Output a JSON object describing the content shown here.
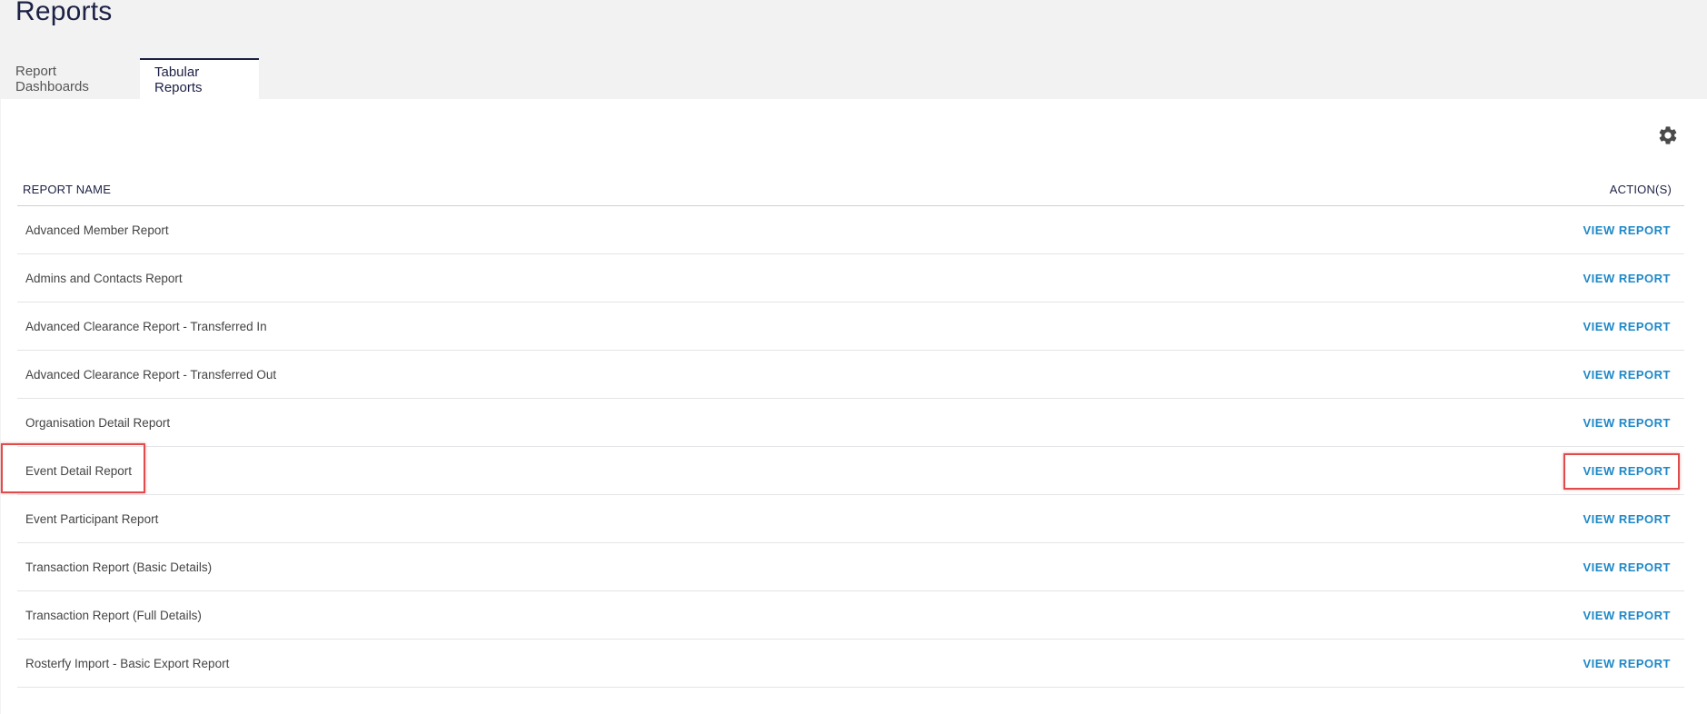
{
  "page": {
    "title": "Reports"
  },
  "tabs": [
    {
      "label": "Report Dashboards",
      "active": false
    },
    {
      "label": "Tabular Reports",
      "active": true
    }
  ],
  "settings": {
    "icon": "gear-icon"
  },
  "table": {
    "headers": {
      "name": "REPORT NAME",
      "actions": "ACTION(S)"
    },
    "rows": [
      {
        "name": "Advanced Member Report",
        "action": "VIEW REPORT"
      },
      {
        "name": "Admins and Contacts Report",
        "action": "VIEW REPORT"
      },
      {
        "name": "Advanced Clearance Report - Transferred In",
        "action": "VIEW REPORT"
      },
      {
        "name": "Advanced Clearance Report - Transferred Out",
        "action": "VIEW REPORT"
      },
      {
        "name": "Organisation Detail Report",
        "action": "VIEW REPORT"
      },
      {
        "name": "Event Detail Report",
        "action": "VIEW REPORT"
      },
      {
        "name": "Event Participant Report",
        "action": "VIEW REPORT"
      },
      {
        "name": "Transaction Report (Basic Details)",
        "action": "VIEW REPORT"
      },
      {
        "name": "Transaction Report (Full Details)",
        "action": "VIEW REPORT"
      },
      {
        "name": "Rosterfy Import - Basic Export Report",
        "action": "VIEW REPORT"
      }
    ]
  },
  "colors": {
    "accent": "#1d2145",
    "link": "#1e88c7",
    "highlight": "#e04b4b"
  }
}
